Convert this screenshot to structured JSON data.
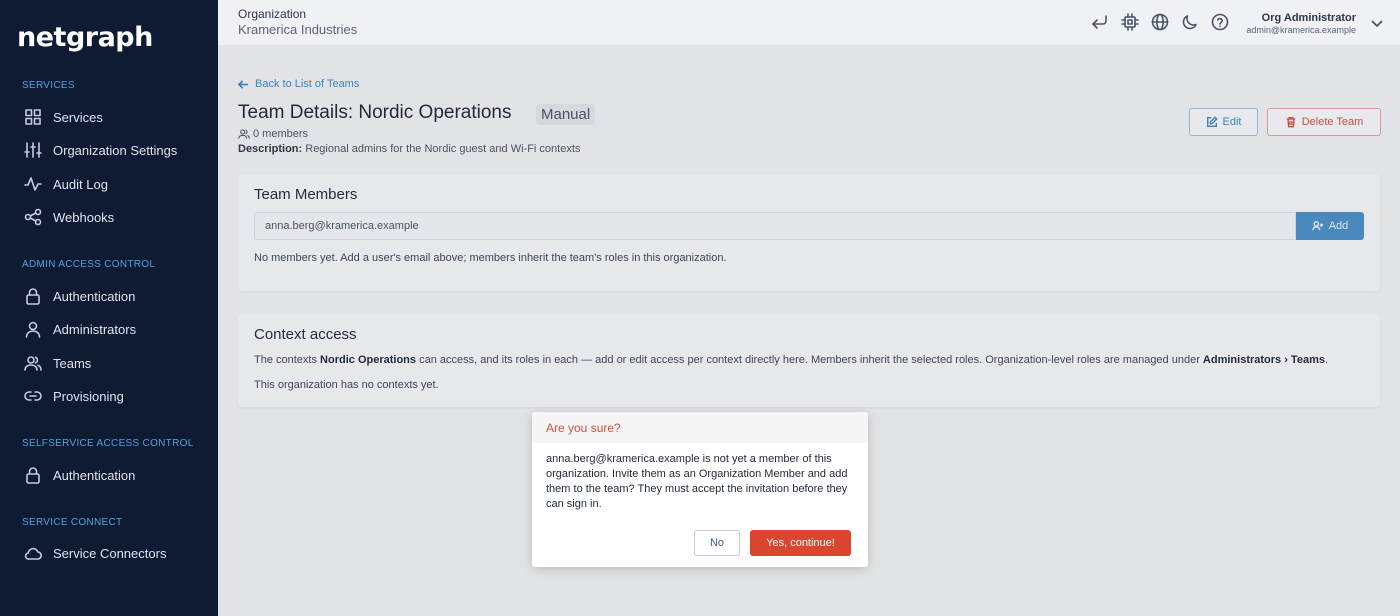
{
  "app": {
    "logo": "netgraph"
  },
  "colors": {
    "sidebar_bg": "#0f1b33",
    "accent": "#4b90c8",
    "danger": "#d9452f"
  },
  "sidebar": {
    "sections": [
      {
        "title": "SERVICES",
        "items": [
          {
            "label": "Services",
            "icon": "grid-icon"
          },
          {
            "label": "Organization Settings",
            "icon": "sliders-icon"
          },
          {
            "label": "Audit Log",
            "icon": "activity-icon"
          },
          {
            "label": "Webhooks",
            "icon": "share-icon"
          }
        ]
      },
      {
        "title": "ADMIN ACCESS CONTROL",
        "items": [
          {
            "label": "Authentication",
            "icon": "lock-icon"
          },
          {
            "label": "Administrators",
            "icon": "user-icon"
          },
          {
            "label": "Teams",
            "icon": "users-icon"
          },
          {
            "label": "Provisioning",
            "icon": "link-icon"
          }
        ]
      },
      {
        "title": "SELFSERVICE ACCESS CONTROL",
        "items": [
          {
            "label": "Authentication",
            "icon": "lock-icon"
          }
        ]
      },
      {
        "title": "SERVICE CONNECT",
        "items": [
          {
            "label": "Service Connectors",
            "icon": "cloud-icon"
          }
        ]
      }
    ]
  },
  "topbar": {
    "org_label": "Organization",
    "org_name": "Kramerica Industries",
    "icons": [
      "return-icon",
      "chip-icon",
      "globe-icon",
      "moon-icon",
      "help-icon"
    ],
    "user_name": "Org Administrator",
    "user_email": "admin@kramerica.example"
  },
  "main": {
    "back_link": "Back to List of Teams",
    "title": "Team Details: Nordic Operations",
    "badge": "Manual",
    "members_count": "0 members",
    "description_label": "Description:",
    "description": "Regional admins for the Nordic guest and Wi-Fi contexts",
    "edit_label": "Edit",
    "delete_label": "Delete Team"
  },
  "team_members": {
    "title": "Team Members",
    "input_value": "anna.berg@kramerica.example",
    "add_label": "Add",
    "empty_text": "No members yet. Add a user's email above; members inherit the team's roles in this organization."
  },
  "context_access": {
    "title": "Context access",
    "text_1": "The contexts ",
    "team_name": "Nordic Operations",
    "text_2": " can access, and its roles in each — add or edit access per context directly here. Members inherit the selected roles. Organization-level roles are managed under ",
    "admin_path": "Administrators › Teams",
    "text_3": ".",
    "empty_text": "This organization has no contexts yet."
  },
  "dialog": {
    "title": "Are you sure?",
    "body": "anna.berg@kramerica.example is not yet a member of this organization. Invite them as an Organization Member and add them to the team? They must accept the invitation before they can sign in.",
    "no_label": "No",
    "yes_label": "Yes, continue!"
  }
}
